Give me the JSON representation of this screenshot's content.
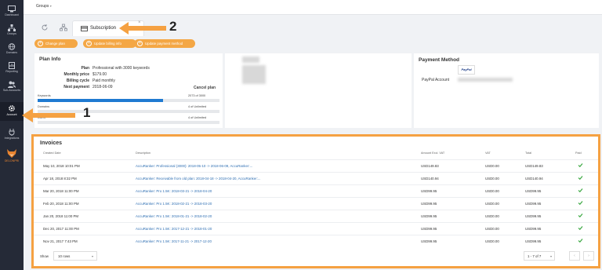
{
  "sidebar": {
    "items": [
      {
        "label": "Dashboard",
        "icon": "monitor-icon"
      },
      {
        "label": "Groups",
        "icon": "sitemap-icon"
      },
      {
        "label": "Domains",
        "icon": "globe-icon"
      },
      {
        "label": "Reporting",
        "icon": "chart-icon"
      },
      {
        "label": "Sub-Accounts",
        "icon": "users-icon"
      },
      {
        "label": "Account",
        "icon": "gear-icon"
      },
      {
        "label": "Integrations",
        "icon": "plug-icon"
      }
    ],
    "bottom_label": "DELONPRI"
  },
  "topbar": {
    "groups_label": "Groups"
  },
  "tabs": {
    "active_label": "Subscription"
  },
  "buttons": {
    "change_plan": "Change plan",
    "update_billing": "Update billing info",
    "update_payment": "Update payment method"
  },
  "plan": {
    "title": "Plan Info",
    "rows": [
      {
        "k": "Plan",
        "v": "Professional with 3000 keywords"
      },
      {
        "k": "Monthly price",
        "v": "$179.00"
      },
      {
        "k": "Billing cycle",
        "v": "Paid monthly"
      },
      {
        "k": "Next payment",
        "v": "2018-06-09"
      }
    ],
    "cancel": "Cancel plan",
    "usage": [
      {
        "label": "Keywords",
        "value": "2073 of 3000",
        "fraction": 0.69
      },
      {
        "label": "Domains",
        "value": "4 of Unlimited",
        "fraction": 0
      },
      {
        "label": "Users",
        "value": "4 of Unlimited",
        "fraction": 0
      }
    ]
  },
  "payment": {
    "title": "Payment Method",
    "provider": "PayPal",
    "account_label": "PayPal Account"
  },
  "invoices": {
    "title": "Invoices",
    "columns": [
      "Created Date",
      "Description",
      "Amount Excl. VAT",
      "VAT",
      "Total",
      "Paid"
    ],
    "rows": [
      {
        "date": "May 10, 2018 10:01 PM",
        "desc": "AccuRanker: Professional (3000): 2018-05-10 -> 2018-06-09, AccuRanker:...",
        "amount": "USD149.83",
        "vat": "USD0.00",
        "total": "USD149.83"
      },
      {
        "date": "Apr 18, 2018 8:32 PM",
        "desc": "AccuRanker: Receivable from old plan: 2018-04-18 -> 2018-04-20, AccuRanker:...",
        "amount": "USD140.94",
        "vat": "USD0.00",
        "total": "USD140.94"
      },
      {
        "date": "Mar 20, 2018 11:00 PM",
        "desc": "AccuRanker: Pro 1.5K: 2018-03-21 -> 2018-04-20",
        "amount": "USD99.95",
        "vat": "USD0.00",
        "total": "USD99.95"
      },
      {
        "date": "Feb 20, 2018 11:00 PM",
        "desc": "AccuRanker: Pro 1.5K: 2018-02-21 -> 2018-03-20",
        "amount": "USD99.95",
        "vat": "USD0.00",
        "total": "USD99.95"
      },
      {
        "date": "Jan 20, 2018 11:00 PM",
        "desc": "AccuRanker: Pro 1.5K: 2018-01-21 -> 2018-02-20",
        "amount": "USD99.95",
        "vat": "USD0.00",
        "total": "USD99.95"
      },
      {
        "date": "Dec 20, 2017 11:00 PM",
        "desc": "AccuRanker: Pro 1.5K: 2017-12-21 -> 2018-01-20",
        "amount": "USD99.95",
        "vat": "USD0.00",
        "total": "USD99.95"
      },
      {
        "date": "Nov 21, 2017 7:43 PM",
        "desc": "AccuRanker: Pro 1.5K: 2017-11-21 -> 2017-12-20",
        "amount": "USD99.95",
        "vat": "USD0.00",
        "total": "USD99.95"
      }
    ],
    "show_label": "Show",
    "rows_select": "10 rows",
    "pager": "1 - 7 of 7"
  },
  "annotations": {
    "one": "1",
    "two": "2"
  },
  "colors": {
    "accent": "#f5a142",
    "sidebar": "#252a37",
    "link": "#2f6fb3",
    "check": "#3aa841"
  }
}
